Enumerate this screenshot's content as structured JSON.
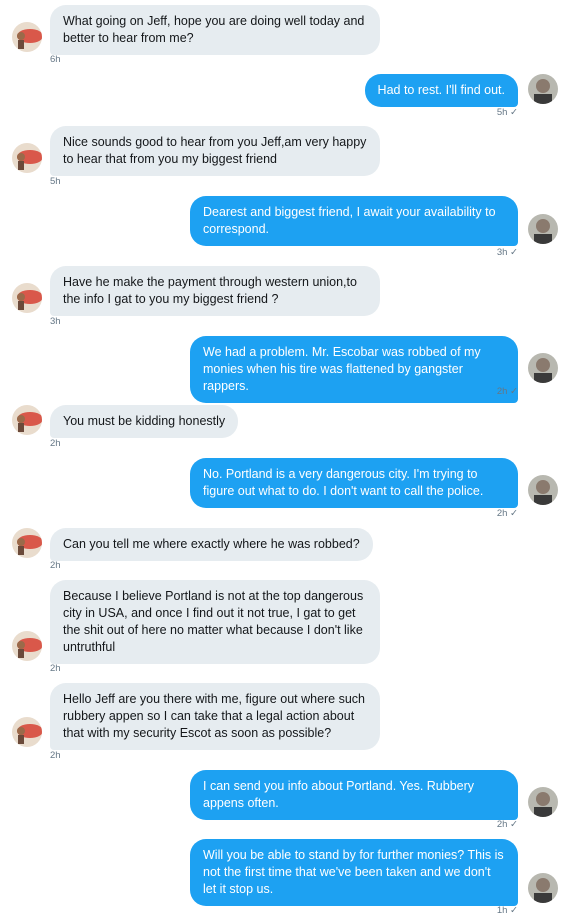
{
  "messages": [
    {
      "dir": "in",
      "text": "What going on Jeff, hope you are doing well today and better to hear from me?",
      "time": "6h"
    },
    {
      "dir": "out",
      "text": "Had to rest. I'll find out.",
      "time": "5h ✓"
    },
    {
      "dir": "in",
      "text": "Nice sounds good to hear from you Jeff,am very happy to hear that from you  my biggest friend",
      "time": "5h"
    },
    {
      "dir": "out",
      "text": "Dearest and biggest friend, I await your availability to correspond.",
      "time": "3h ✓"
    },
    {
      "dir": "in",
      "text": "Have he make the payment  through western union,to the info I gat to you my biggest friend ?",
      "time": "3h"
    },
    {
      "dir": "out",
      "text": "We had a problem. Mr. Escobar was robbed of my monies when his tire was flattened by gangster rappers.",
      "time": "2h ✓"
    },
    {
      "dir": "in",
      "text": "You must be kidding honestly",
      "time": "2h"
    },
    {
      "dir": "out",
      "text": "No. Portland is a very dangerous city. I'm trying to figure out what to do. I don't want to call the police.",
      "time": "2h ✓"
    },
    {
      "dir": "in",
      "text": "Can you tell me where exactly where he was robbed?",
      "time": "2h"
    },
    {
      "dir": "in",
      "text": "Because I believe Portland is not at the top dangerous city in USA, and once I find out it not true, I gat to get the shit out of here no matter what because I don't like untruthful",
      "time": "2h"
    },
    {
      "dir": "in",
      "text": "Hello Jeff are you there with me, figure out where such rubbery appen so I can take that a legal action about that with my security Escot as soon as possible?",
      "time": "2h"
    },
    {
      "dir": "out",
      "text": "I can send you info about Portland. Yes. Rubbery appens often.",
      "time": "2h ✓"
    },
    {
      "dir": "out",
      "text": "Will you be able to stand by for further monies? This is not the first time that we've been taken and we don't let it stop us.",
      "time": "1h ✓"
    }
  ]
}
